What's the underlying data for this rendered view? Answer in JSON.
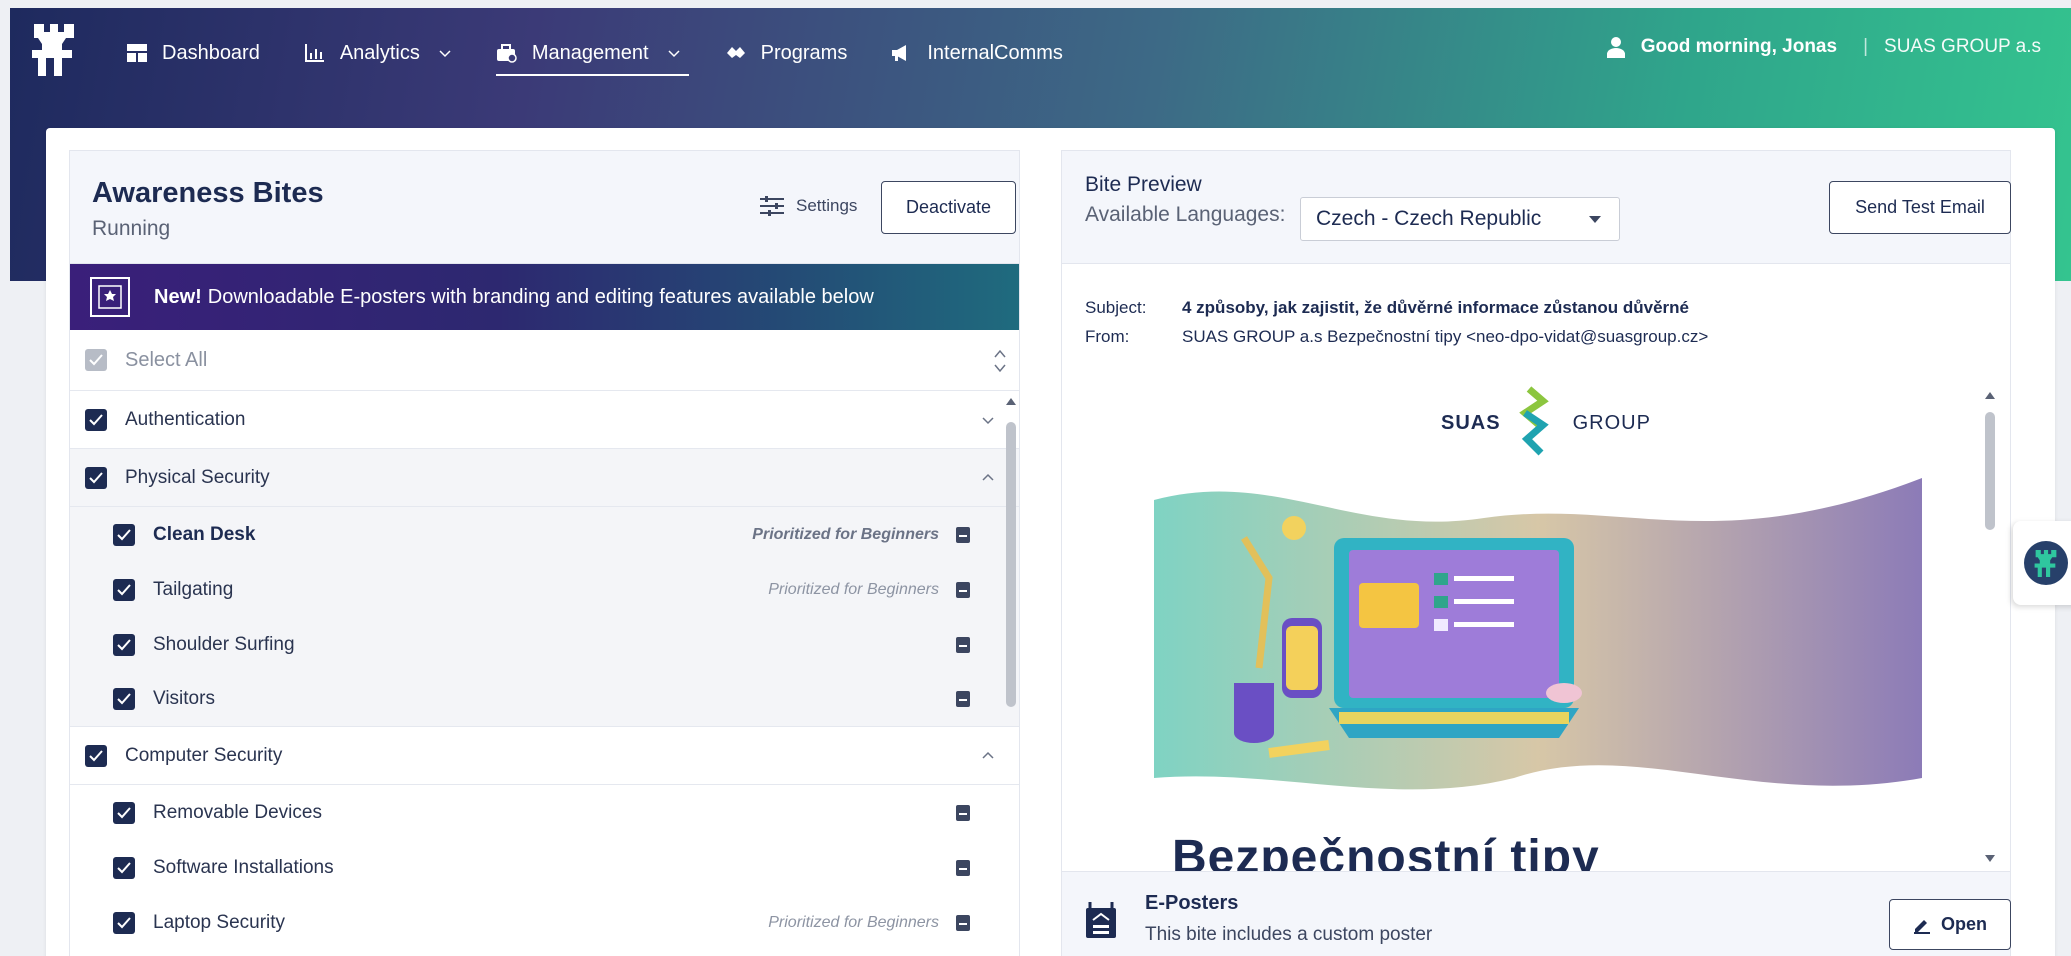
{
  "nav": {
    "items": [
      {
        "label": "Dashboard",
        "icon": "dashboard-icon"
      },
      {
        "label": "Analytics",
        "icon": "analytics-icon"
      },
      {
        "label": "Management",
        "icon": "management-icon"
      },
      {
        "label": "Programs",
        "icon": "programs-icon"
      },
      {
        "label": "InternalComms",
        "icon": "megaphone-icon"
      }
    ],
    "greeting": "Good morning, Jonas",
    "separator": "|",
    "org": "SUAS GROUP a.s"
  },
  "left": {
    "title": "Awareness Bites",
    "status": "Running",
    "settings_label": "Settings",
    "deactivate_label": "Deactivate",
    "banner_new": "New!",
    "banner_text": "Downloadable E-posters with branding and editing features available below",
    "select_all": "Select All",
    "categories": [
      {
        "label": "Authentication"
      },
      {
        "label": "Physical Security"
      },
      {
        "label": "Computer Security"
      }
    ],
    "physical_items": [
      {
        "label": "Clean Desk",
        "tag": "Prioritized for Beginners"
      },
      {
        "label": "Tailgating",
        "tag": "Prioritized for Beginners"
      },
      {
        "label": "Shoulder Surfing",
        "tag": ""
      },
      {
        "label": "Visitors",
        "tag": ""
      }
    ],
    "computer_items": [
      {
        "label": "Removable Devices",
        "tag": ""
      },
      {
        "label": "Software Installations",
        "tag": ""
      },
      {
        "label": "Laptop Security",
        "tag": "Prioritized for Beginners"
      }
    ]
  },
  "right": {
    "title": "Bite Preview",
    "languages_label": "Available Languages:",
    "language_selected": "Czech - Czech Republic",
    "send_test_label": "Send Test Email",
    "subject_key": "Subject:",
    "subject_value": "4 způsoby, jak zajistit, že důvěrné informace zůstanou důvěrné",
    "from_key": "From:",
    "from_value": "SUAS GROUP a.s Bezpečnostní tipy <neo-dpo-vidat@suasgroup.cz>",
    "brand_left": "SUAS",
    "brand_right": "GROUP",
    "hero_title": "Bezpečnostní tipy",
    "eposters_title": "E-Posters",
    "eposters_desc": "This bite includes a custom poster",
    "open_label": "Open"
  },
  "colors": {
    "navy": "#1d2b52",
    "accent_green": "#34c48f",
    "banner_purple": "#3a1f7a"
  }
}
